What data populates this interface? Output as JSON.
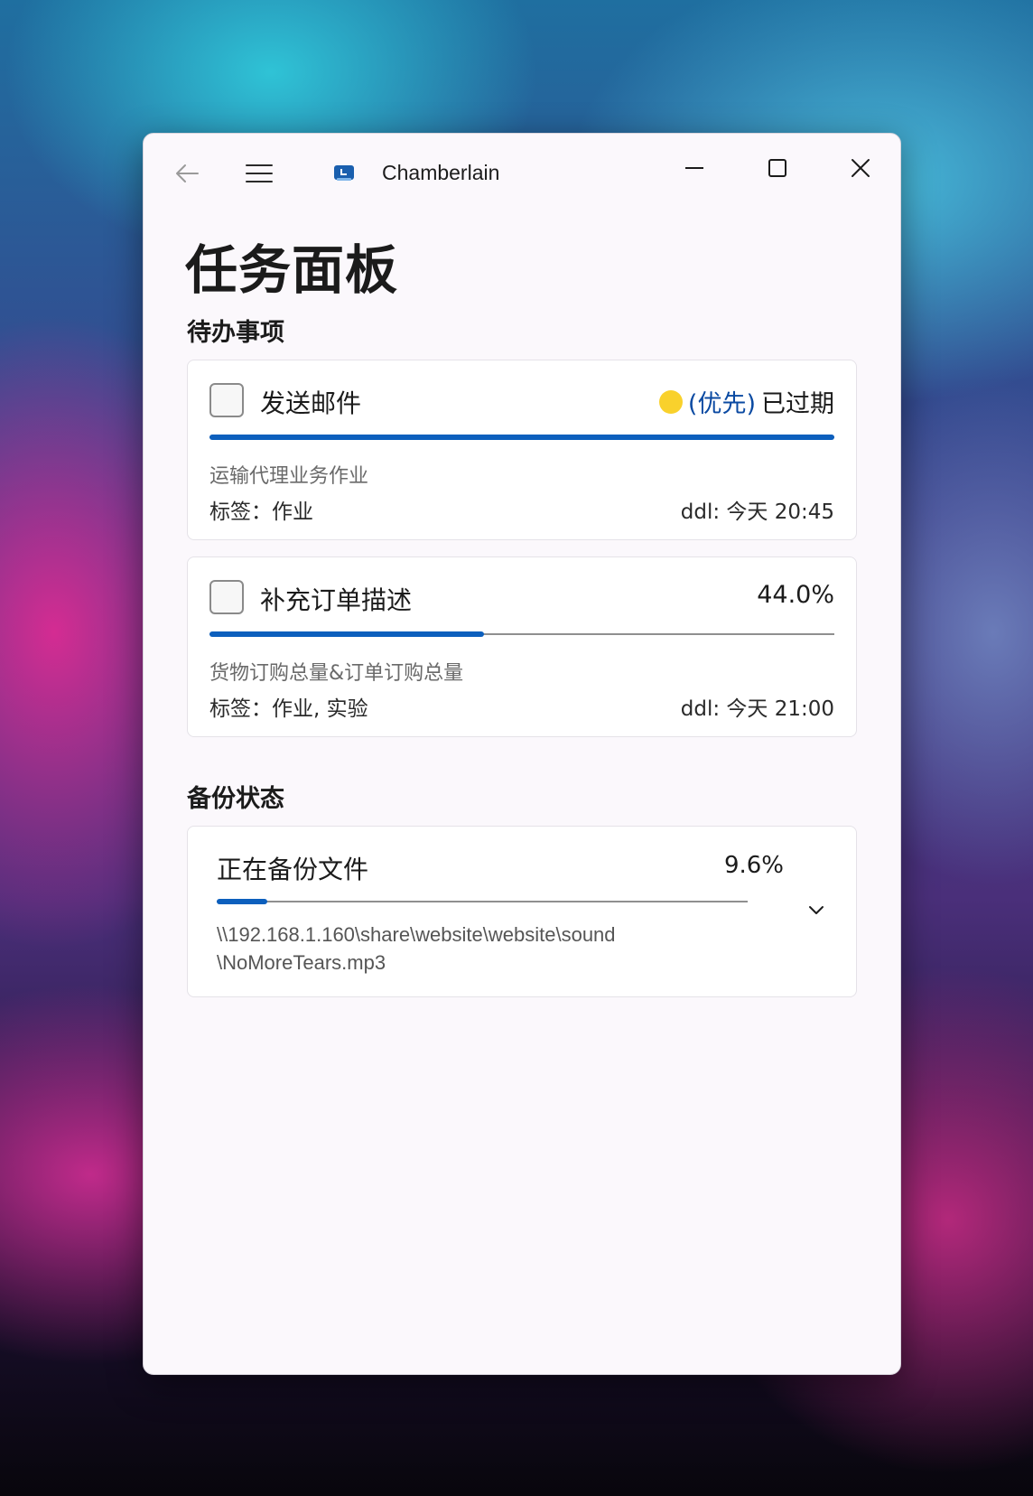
{
  "window": {
    "app_title": "Chamberlain",
    "back_icon": "back-arrow-icon",
    "menu_icon": "hamburger-menu-icon",
    "app_icon": "app-logo-icon"
  },
  "page": {
    "title": "任务面板"
  },
  "todo": {
    "section_title": "待办事项",
    "tasks": [
      {
        "name": "发送邮件",
        "priority_label": "(优先)",
        "priority_color": "#f9d12c",
        "status": "已过期",
        "progress": 1.0,
        "description": "运输代理业务作业",
        "tags": "标签：作业",
        "ddl": "ddl: 今天 20:45"
      },
      {
        "name": "补充订单描述",
        "status": "44.0%",
        "progress": 0.44,
        "description": "货物订购总量&订单订购总量",
        "tags": "标签：作业, 实验",
        "ddl": "ddl: 今天 21:00"
      }
    ]
  },
  "backup": {
    "section_title": "备份状态",
    "label": "正在备份文件",
    "percent": "9.6%",
    "progress": 0.096,
    "path_line1": "\\\\192.168.1.160\\share\\website\\website\\sound",
    "path_line2": "\\NoMoreTears.mp3",
    "expand_icon": "chevron-down-icon"
  },
  "colors": {
    "accent": "#0c5fbd",
    "priority_text": "#0b4aa2"
  }
}
